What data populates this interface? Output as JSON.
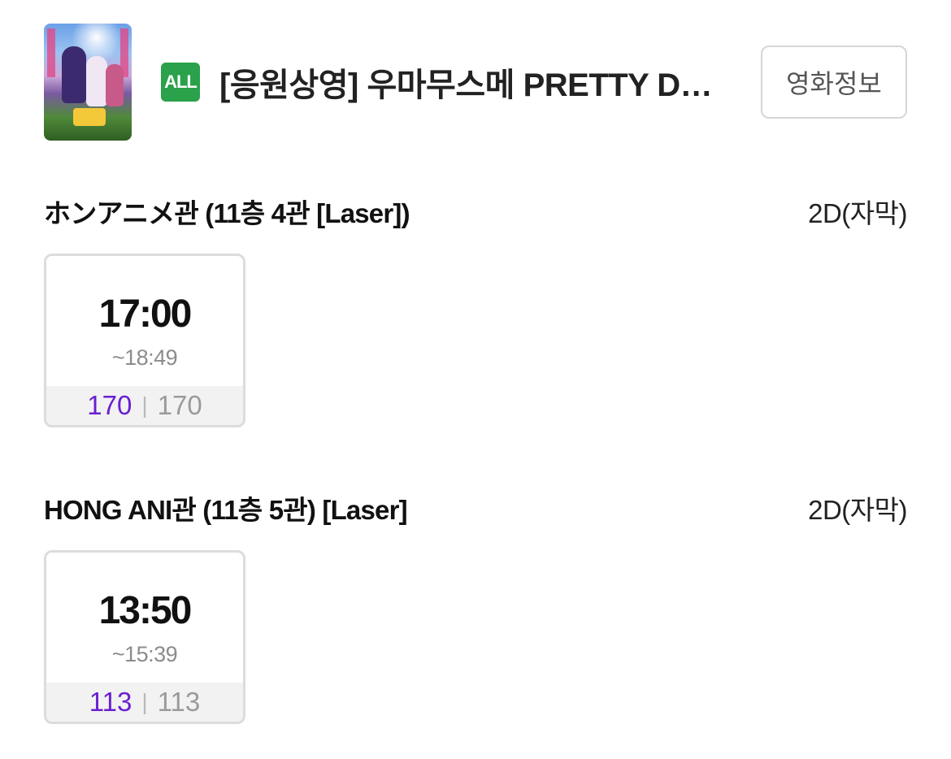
{
  "movie": {
    "rating_badge": "ALL",
    "title": "[응원상영] 우마무스메 PRETTY DERBY",
    "info_button": "영화정보"
  },
  "theaters": [
    {
      "name": "ホンアニメ관 (11층 4관 [Laser])",
      "format": "2D(자막)",
      "showtimes": [
        {
          "start": "17:00",
          "end": "~18:49",
          "available": "170",
          "total": "170"
        }
      ]
    },
    {
      "name": "HONG ANI관 (11층 5관) [Laser]",
      "format": "2D(자막)",
      "showtimes": [
        {
          "start": "13:50",
          "end": "~15:39",
          "available": "113",
          "total": "113"
        }
      ]
    }
  ],
  "colors": {
    "rating_green": "#2aa14a",
    "available_seats": "#6a1fd0",
    "card_border": "#dcdcdc"
  }
}
